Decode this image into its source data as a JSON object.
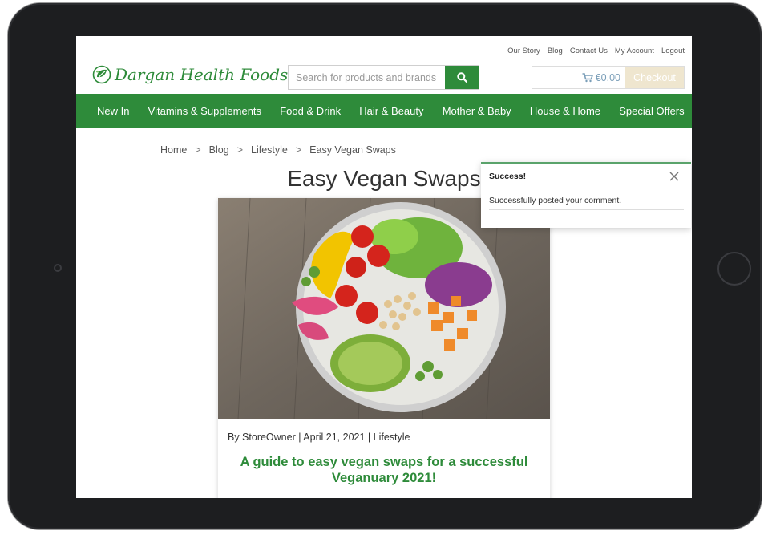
{
  "header": {
    "top_links": [
      "Our Story",
      "Blog",
      "Contact Us",
      "My Account",
      "Logout"
    ],
    "logo_text": "Dargan Health Foods",
    "search_placeholder": "Search for products and brands",
    "search_icon": "search-icon",
    "cart_total": "€0.00",
    "cart_icon": "cart-icon",
    "checkout_label": "Checkout"
  },
  "nav": {
    "items": [
      "New In",
      "Vitamins & Supplements",
      "Food & Drink",
      "Hair & Beauty",
      "Mother & Baby",
      "House & Home",
      "Special Offers"
    ]
  },
  "breadcrumb": {
    "items": [
      "Home",
      "Blog",
      "Lifestyle",
      "Easy Vegan Swaps"
    ],
    "separator": ">"
  },
  "page": {
    "title": "Easy Vegan Swaps"
  },
  "article": {
    "meta_by": "By StoreOwner",
    "meta_date": "April 21, 2021",
    "meta_category": "Lifestyle",
    "meta_divider": "|",
    "title_line1": "A guide to easy vegan swaps for a successful",
    "title_line2": "Veganuary 2021!"
  },
  "toast": {
    "title": "Success!",
    "message": "Successfully posted your comment.",
    "close_icon": "close-icon"
  },
  "colors": {
    "brand_green": "#2e8b3a",
    "checkout_bg": "#efe6cf",
    "device_frame": "#1d1e20"
  }
}
